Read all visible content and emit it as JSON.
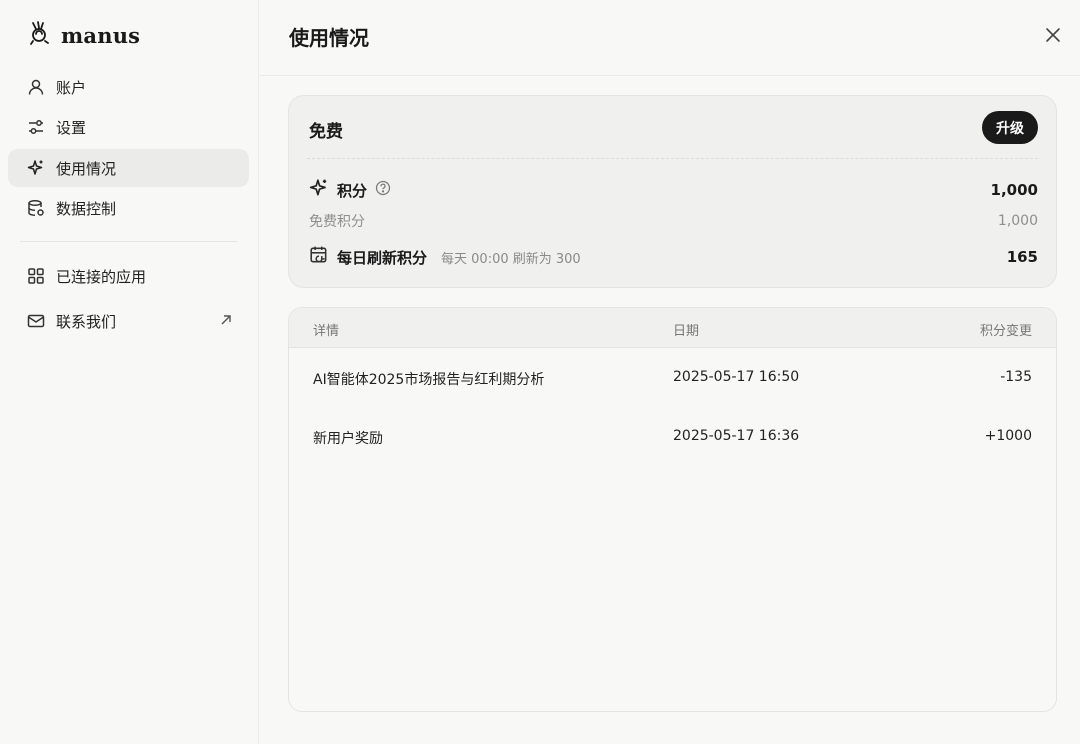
{
  "brand": {
    "name": "manus"
  },
  "sidebar": {
    "items": [
      {
        "label": "账户",
        "icon": "user-icon"
      },
      {
        "label": "设置",
        "icon": "sliders-icon"
      },
      {
        "label": "使用情况",
        "icon": "sparkle-icon",
        "active": true
      },
      {
        "label": "数据控制",
        "icon": "database-icon"
      },
      {
        "label": "已连接的应用",
        "icon": "grid-icon"
      },
      {
        "label": "联系我们",
        "icon": "mail-icon",
        "external": true
      }
    ]
  },
  "page": {
    "title": "使用情况"
  },
  "plan": {
    "name": "免费",
    "upgrade_label": "升级",
    "credits_label": "积分",
    "credits_value": "1,000",
    "free_credits_label": "免费积分",
    "free_credits_value": "1,000",
    "daily_label": "每日刷新积分",
    "daily_note": "每天 00:00 刷新为 300",
    "daily_value": "165"
  },
  "table": {
    "headers": [
      "详情",
      "日期",
      "积分变更"
    ],
    "rows": [
      {
        "detail": "AI智能体2025市场报告与红利期分析",
        "date": "2025-05-17 16:50",
        "change": "-135"
      },
      {
        "detail": "新用户奖励",
        "date": "2025-05-17 16:36",
        "change": "+1000"
      }
    ]
  },
  "colors": {
    "background": "#f8f8f7",
    "card": "#f0f0ef",
    "accent": "#1a1a1a"
  }
}
